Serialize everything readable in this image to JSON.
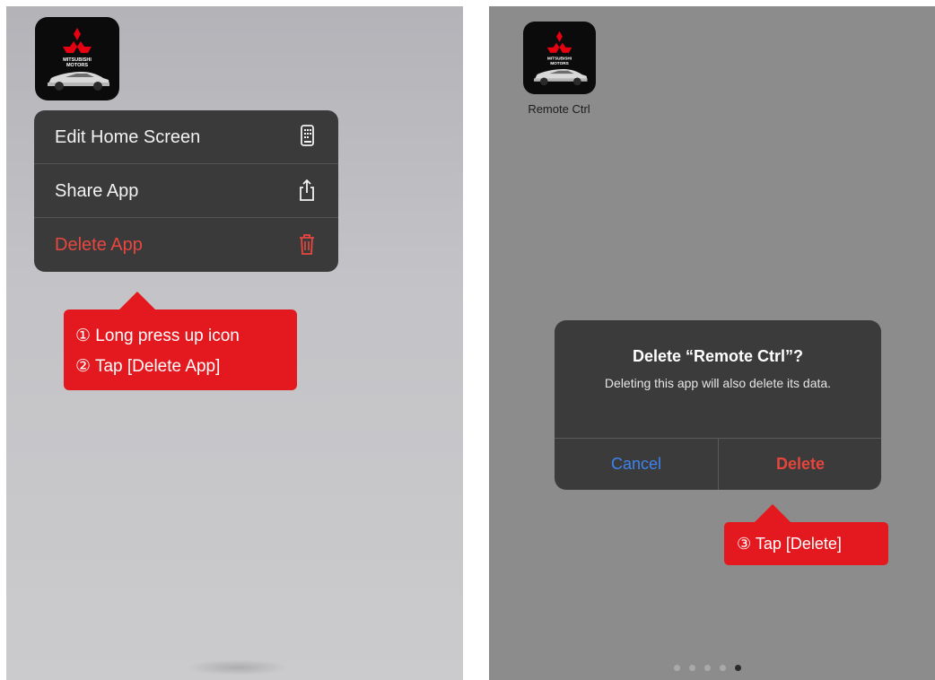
{
  "left_screen": {
    "app_icon": {
      "name": "mitsubishi-motors-app-icon",
      "logo_text": "MITSUBISHI MOTORS"
    },
    "context_menu": {
      "items": [
        {
          "label": "Edit Home Screen",
          "icon": "phone-grid-icon"
        },
        {
          "label": "Share App",
          "icon": "share-icon"
        },
        {
          "label": "Delete App",
          "icon": "trash-icon",
          "destructive": true
        }
      ]
    },
    "callout": {
      "lines": [
        "① Long press up icon",
        "② Tap [Delete App]"
      ]
    }
  },
  "right_screen": {
    "app_icon": {
      "name": "mitsubishi-motors-app-icon",
      "logo_text": "MITSUBISHI MOTORS"
    },
    "app_label": "Remote Ctrl",
    "alert": {
      "title": "Delete “Remote Ctrl”?",
      "message": "Deleting this app will also delete its data.",
      "cancel_label": "Cancel",
      "delete_label": "Delete"
    },
    "callout": {
      "lines": [
        "③ Tap [Delete]"
      ]
    },
    "page_dots": {
      "count": 5,
      "active_index": 4
    }
  },
  "colors": {
    "callout_red": "#e3191f",
    "destructive_red": "#e7443c",
    "cancel_blue": "#3f83f0",
    "menu_bg": "#3a3a3b"
  }
}
